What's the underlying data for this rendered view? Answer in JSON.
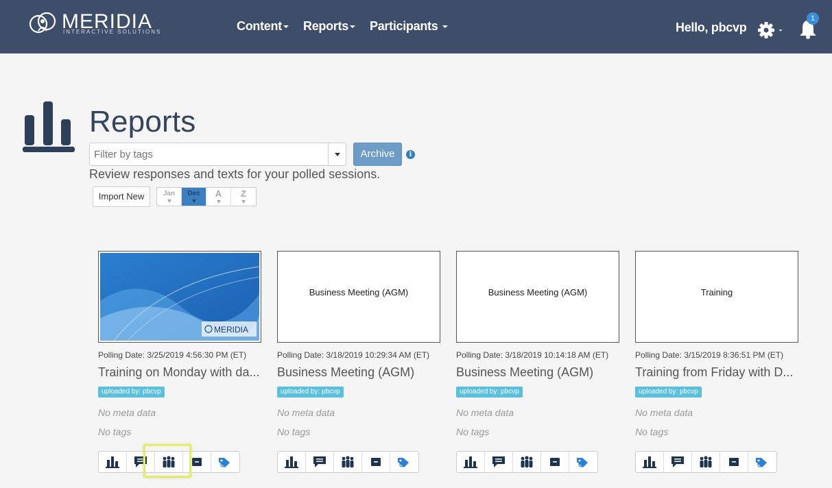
{
  "brand": {
    "name": "MERIDIA",
    "subtitle": "INTERACTIVE SOLUTIONS"
  },
  "nav": {
    "items": [
      {
        "label": "Content"
      },
      {
        "label": "Reports"
      },
      {
        "label": "Participants"
      }
    ],
    "greeting": "Hello, pbcvp",
    "notification_count": "1"
  },
  "page": {
    "title": "Reports",
    "filter_placeholder": "Filter by tags",
    "archive_label": "Archive",
    "subtitle": "Review responses and texts for your polled sessions.",
    "import_label": "Import New",
    "sort_buttons": [
      {
        "label": "Jan",
        "active": false
      },
      {
        "label": "Dec",
        "active": true
      },
      {
        "label": "A",
        "active": false
      },
      {
        "label": "Z",
        "active": false
      }
    ]
  },
  "cards": [
    {
      "thumb_text": "",
      "thumb_logo": "MERIDIA",
      "polling_label": "Polling Date:",
      "polling_date": "3/25/2019 4:56:30 PM (ET)",
      "title": "Training on Monday with da...",
      "uploaded": "uploaded by: pbcvp",
      "meta": "No meta data",
      "tags": "No tags"
    },
    {
      "thumb_text": "Business Meeting (AGM)",
      "polling_label": "Polling Date:",
      "polling_date": "3/18/2019 10:29:34 AM (ET)",
      "title": "Business Meeting (AGM)",
      "uploaded": "uploaded by: pbcvp",
      "meta": "No meta data",
      "tags": "No tags"
    },
    {
      "thumb_text": "Business Meeting (AGM)",
      "polling_label": "Polling Date:",
      "polling_date": "3/18/2019 10:14:18 AM (ET)",
      "title": "Business Meeting (AGM)",
      "uploaded": "uploaded by: pbcvp",
      "meta": "No meta data",
      "tags": "No tags"
    },
    {
      "thumb_text": "Training",
      "polling_label": "Polling Date:",
      "polling_date": "3/15/2019 8:36:51 PM (ET)",
      "title": "Training from Friday with D...",
      "uploaded": "uploaded by: pbcvp",
      "meta": "No meta data",
      "tags": "No tags"
    }
  ],
  "card_actions": [
    "bar-chart-icon",
    "comment-icon",
    "participants-icon",
    "archive-box-icon",
    "tag-icon"
  ],
  "colors": {
    "navbar": "#3d4d6a",
    "accent": "#3b7fc1",
    "badge": "#5bc0de",
    "highlight": "#e4ec6b"
  }
}
